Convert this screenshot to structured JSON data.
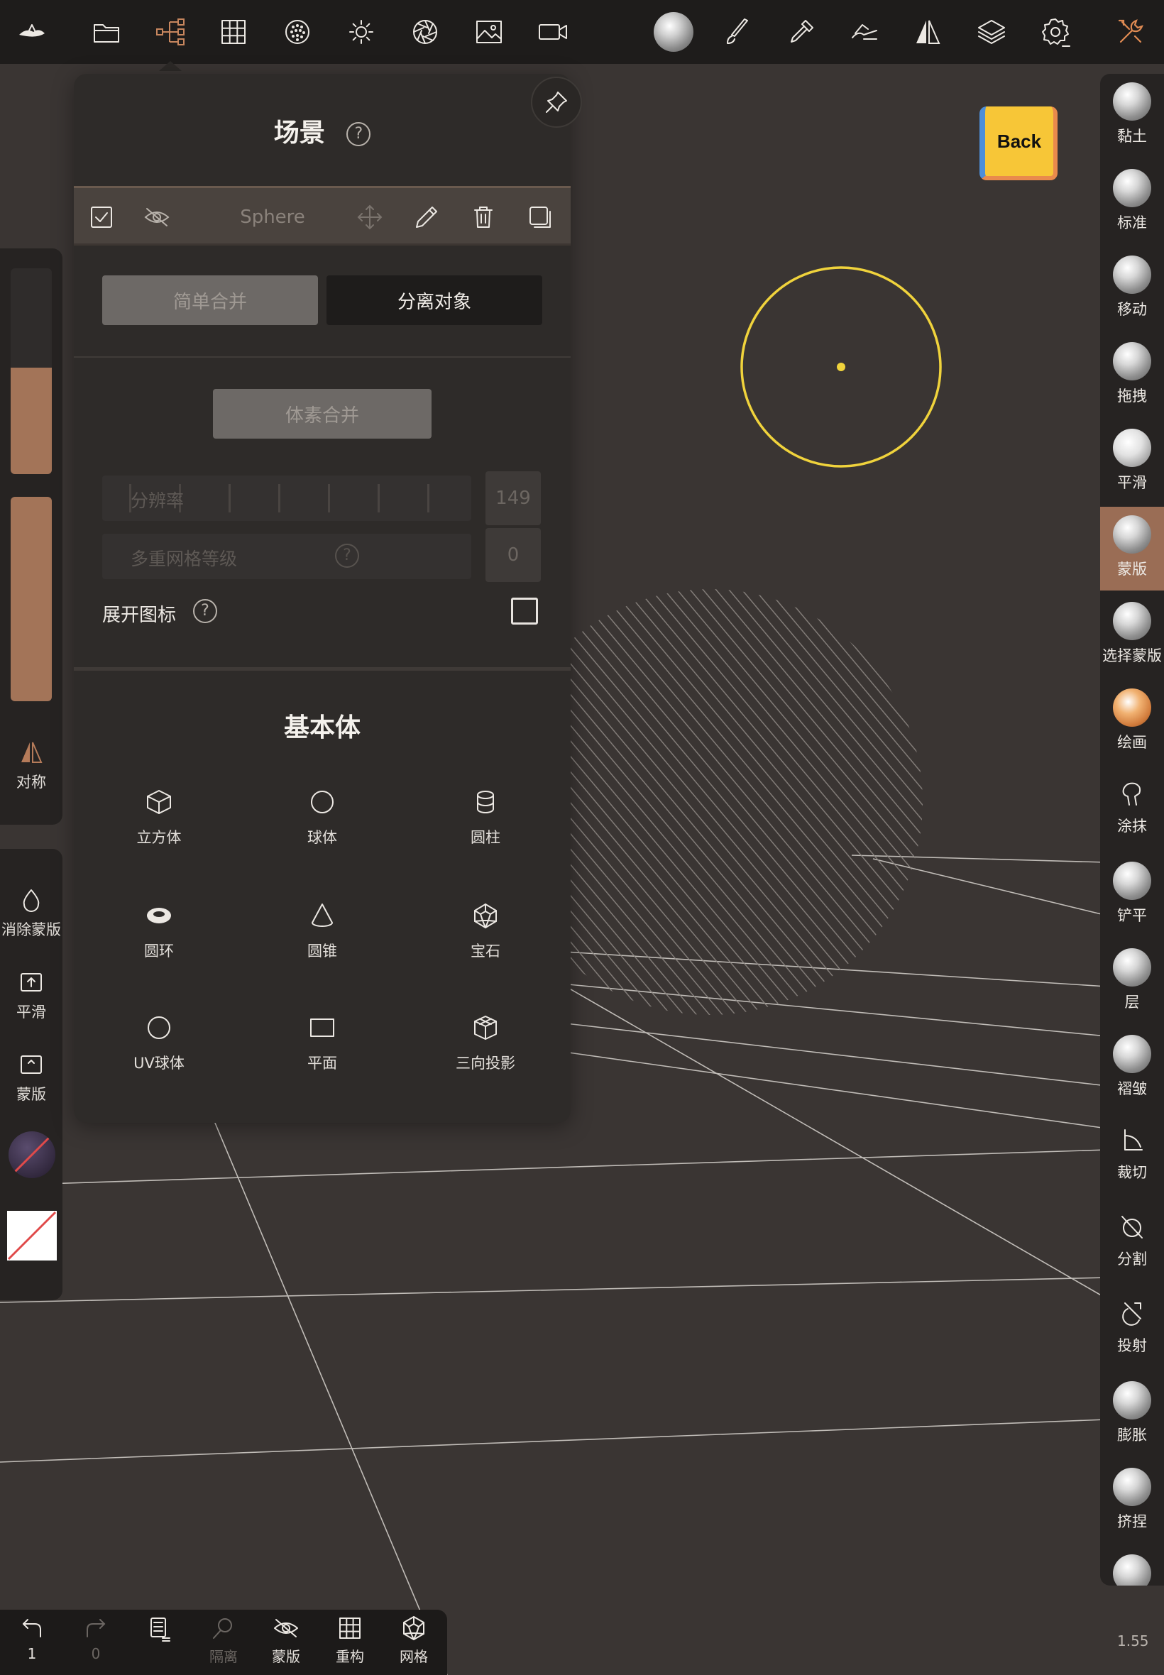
{
  "scene_panel": {
    "title": "场景",
    "object_name": "Sphere",
    "btn_simple_merge": "简单合并",
    "btn_separate": "分离对象",
    "btn_voxel_merge": "体素合并",
    "resolution_label": "分辨率",
    "resolution_value": "149",
    "multires_label": "多重网格等级",
    "multires_value": "0",
    "expand_icons_label": "展开图标",
    "primitives_title": "基本体",
    "primitives": [
      {
        "label": "立方体",
        "icon": "cube-icon"
      },
      {
        "label": "球体",
        "icon": "sphere-icon"
      },
      {
        "label": "圆柱",
        "icon": "cylinder-icon"
      },
      {
        "label": "圆环",
        "icon": "torus-icon"
      },
      {
        "label": "圆锥",
        "icon": "cone-icon"
      },
      {
        "label": "宝石",
        "icon": "gem-icon"
      },
      {
        "label": "UV球体",
        "icon": "uv-sphere-icon"
      },
      {
        "label": "平面",
        "icon": "plane-icon"
      },
      {
        "label": "三向投影",
        "icon": "triplanar-icon"
      }
    ]
  },
  "left_panel": {
    "symmetry": "对称",
    "clear_mask": "消除蒙版",
    "smooth": "平滑",
    "mask": "蒙版"
  },
  "right_tools": [
    {
      "label": "黏土",
      "icon": "clay-icon"
    },
    {
      "label": "标准",
      "icon": "standard-icon"
    },
    {
      "label": "移动",
      "icon": "move-icon"
    },
    {
      "label": "拖拽",
      "icon": "drag-icon"
    },
    {
      "label": "平滑",
      "icon": "smooth-icon"
    },
    {
      "label": "蒙版",
      "icon": "mask-icon"
    },
    {
      "label": "选择蒙版",
      "icon": "select-mask-icon"
    },
    {
      "label": "绘画",
      "icon": "paint-icon"
    },
    {
      "label": "涂抹",
      "icon": "smudge-icon"
    },
    {
      "label": "铲平",
      "icon": "flatten-icon"
    },
    {
      "label": "层",
      "icon": "layer-icon"
    },
    {
      "label": "褶皱",
      "icon": "crease-icon"
    },
    {
      "label": "裁切",
      "icon": "trim-icon"
    },
    {
      "label": "分割",
      "icon": "split-icon"
    },
    {
      "label": "投射",
      "icon": "project-icon"
    },
    {
      "label": "膨胀",
      "icon": "inflate-icon"
    },
    {
      "label": "挤捏",
      "icon": "pinch-icon"
    }
  ],
  "active_tool": "蒙版",
  "bottom_bar": {
    "undo_count": "1",
    "redo_count": "0",
    "isolate": "隔离",
    "mask": "蒙版",
    "remesh": "重构",
    "wireframe": "网格"
  },
  "cube_label": "Back",
  "zoom": "1.55",
  "colors": {
    "accent": "#9a6d55",
    "highlight": "#f0d33c",
    "panel": "#2e2b29"
  }
}
